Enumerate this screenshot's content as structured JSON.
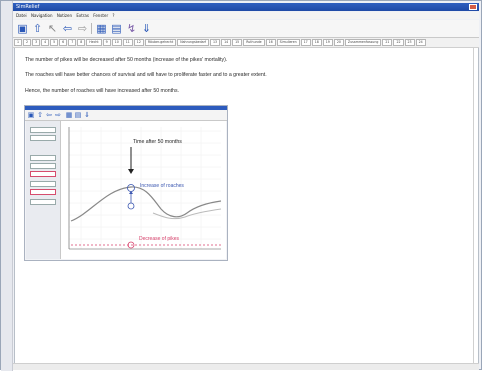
{
  "app": {
    "title": "SimRelief",
    "menus": [
      "Datei",
      "Navigation",
      "Notizen",
      "Extras",
      "Fenster",
      "?"
    ]
  },
  "toolbar": {
    "icons": [
      "book-icon",
      "up-arrow-icon",
      "cursor-icon",
      "back-icon",
      "forward-icon",
      "grid-icon",
      "page-icon",
      "model-icon",
      "download-icon"
    ]
  },
  "navbar": {
    "items": [
      "1",
      "2",
      "3",
      "4",
      "5",
      "6",
      "7",
      "8",
      "Hecht",
      "9",
      "10",
      "11",
      "12",
      "Räuber-gehecht",
      "Nahrungsbedarf",
      "13",
      "14",
      "15",
      "Ruthunde",
      "16",
      "Simulieren",
      "17",
      "18",
      "19",
      "20",
      "Zusammenfassung",
      "21",
      "22",
      "23",
      "24"
    ]
  },
  "content": {
    "line1": "The number of pikes will be decreased after 50 months (increase of the pikes' mortality).",
    "line2": "The roaches will have better chances of survival and will have to proliferate faster and to a greater extent.",
    "line3": "Hence, the number of roaches will have increased after 50 months."
  },
  "figure": {
    "annotation_time": "Time after 50 months",
    "annotation_roach": "Increase of roaches",
    "annotation_pike": "Decrease of pikes",
    "colors": {
      "roach": "#3a56b0",
      "pike": "#d8406b",
      "curve_before": "#8a8a8a",
      "curve_after": "#b9b9b9"
    }
  }
}
